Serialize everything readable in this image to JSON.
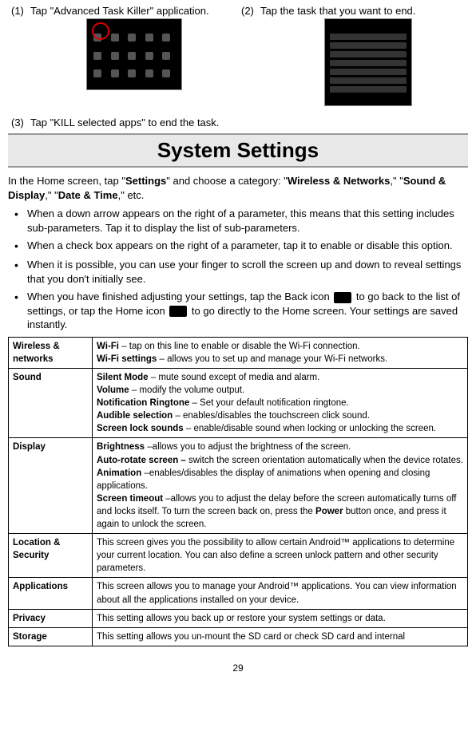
{
  "steps": {
    "s1": {
      "num": "(1)",
      "text": "Tap \"Advanced Task Killer\" application."
    },
    "s2": {
      "num": "(2)",
      "text": "Tap the task that you want to end."
    },
    "s3": {
      "num": "(3)",
      "text": "Tap \"KILL selected apps\" to end the task."
    }
  },
  "section_title": "System Settings",
  "intro": {
    "p1a": "In the Home screen, tap \"",
    "p1b": "Settings",
    "p1c": "\" and choose a category: \"",
    "p1d": "Wireless & Networks",
    "p1e": ",\" \"",
    "p1f": "Sound & Display",
    "p1g": ",\" \"",
    "p1h": "Date & Time",
    "p1i": ",\" etc."
  },
  "bullets": {
    "b1": "When a down arrow appears on the right of a parameter, this means that this setting includes sub-parameters. Tap it to display the list of sub-parameters.",
    "b2": "When a check box appears on the right of a parameter, tap it to enable or disable this option.",
    "b3": "When it is possible, you can use your finger to scroll the screen up and down to reveal settings that you don't initially see.",
    "b4a": "When you have finished adjusting your settings, tap the Back icon ",
    "b4b": " to go back to the list of settings, or tap the Home icon ",
    "b4c": " to go directly to the Home screen. Your settings are saved instantly."
  },
  "table": {
    "wireless": {
      "cat": "Wireless & networks",
      "wifi_b": "Wi-Fi",
      "wifi_t": " – tap on this line to enable or disable the Wi-Fi connection.",
      "wifis_b": "Wi-Fi settings",
      "wifis_t": " – allows you to set up and manage your Wi-Fi networks."
    },
    "sound": {
      "cat": "Sound",
      "silent_b": "Silent Mode",
      "silent_t": " – mute sound except of media and alarm.",
      "vol_b": "Volume",
      "vol_t": " – modify the volume output.",
      "ring_b": "Notification Ringtone",
      "ring_t": " – Set your default notification ringtone.",
      "aud_b": "Audible selection",
      "aud_t": " – enables/disables the touchscreen click sound.",
      "lock_b": "Screen lock sounds",
      "lock_t": " – enable/disable sound when locking or unlocking the screen."
    },
    "display": {
      "cat": "Display",
      "bri_b": "Brightness",
      "bri_t": " –allows you to adjust the brightness of the screen.",
      "rot_b": "Auto-rotate screen – ",
      "rot_t": "switch the screen orientation automatically when the device rotates.",
      "ani_b": "Animation",
      "ani_t": " –enables/disables the display of animations when opening and closing applications.",
      "tim_b": "Screen timeout",
      "tim_t": " –allows you to adjust the delay before the screen automatically turns off and locks itself. To turn the screen back on, press the ",
      "tim_b2": "Power",
      "tim_t2": " button once, and press it again to unlock the screen."
    },
    "location": {
      "cat": "Location & Security",
      "t": "This screen gives you the possibility to allow certain Android™ applications to determine your current location. You can also define a screen unlock pattern and other security parameters."
    },
    "apps": {
      "cat": "Applications",
      "t": "This screen allows you to manage your Android™ applications. You can view information about all the applications installed on your device."
    },
    "privacy": {
      "cat": "Privacy",
      "t": "This setting allows you back up or restore your system settings or data."
    },
    "storage": {
      "cat": "Storage",
      "t": "This setting allows you un-mount the SD card or check SD card and internal"
    }
  },
  "page_num": "29"
}
